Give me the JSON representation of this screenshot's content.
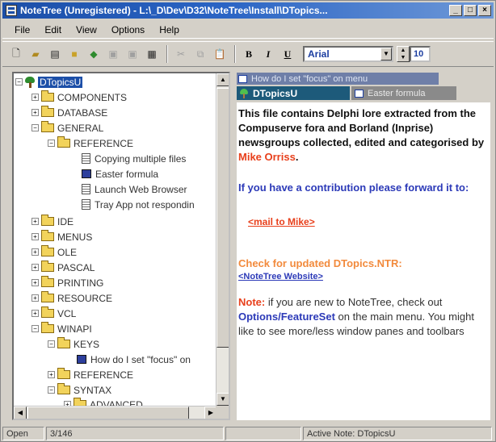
{
  "window": {
    "title": "NoteTree (Unregistered) - L:\\_D\\Dev\\D32\\NoteTree\\Install\\DTopics...",
    "buttons": {
      "minimize": "_",
      "maximize": "□",
      "close": "×"
    }
  },
  "menu": [
    "File",
    "Edit",
    "View",
    "Options",
    "Help"
  ],
  "toolbar": {
    "font_name": "Arial",
    "font_size": "10",
    "bold": "B",
    "italic": "I",
    "underline": "U"
  },
  "tree": {
    "root": "DTopicsU",
    "items": [
      {
        "label": "COMPONENTS",
        "expander": "+"
      },
      {
        "label": "DATABASE",
        "expander": "+"
      },
      {
        "label": "GENERAL",
        "expander": "−"
      },
      {
        "label": "REFERENCE",
        "expander": "−"
      },
      {
        "label": "Copying multiple files"
      },
      {
        "label": "Easter formula"
      },
      {
        "label": "Launch Web Browser"
      },
      {
        "label": "Tray App not respondin"
      },
      {
        "label": "IDE",
        "expander": "+"
      },
      {
        "label": "MENUS",
        "expander": "+"
      },
      {
        "label": "OLE",
        "expander": "+"
      },
      {
        "label": "PASCAL",
        "expander": "+"
      },
      {
        "label": "PRINTING",
        "expander": "+"
      },
      {
        "label": "RESOURCE",
        "expander": "+"
      },
      {
        "label": "VCL",
        "expander": "+"
      },
      {
        "label": "WINAPI",
        "expander": "−"
      },
      {
        "label": "KEYS",
        "expander": "−"
      },
      {
        "label": "How do I set \"focus\" on"
      },
      {
        "label": "REFERENCE",
        "expander": "+"
      },
      {
        "label": "SYNTAX",
        "expander": "−"
      },
      {
        "label": "ADVANCED",
        "expander": "+"
      }
    ]
  },
  "tabs": {
    "top": "How do I set \"focus\" on menu",
    "active": "DTopicsU",
    "inactive": "Easter formula"
  },
  "note": {
    "intro": "This file contains Delphi lore extracted from the Compuserve fora and Borland (Inprise) newsgroups collected, edited and categorised by",
    "author": "Mike Orriss",
    "period": ".",
    "contribution": "If you have a contribution please forward it to:",
    "mail_link": "<mail to Mike>",
    "check_updates": "Check for updated DTopics.NTR:",
    "website_link": "<NoteTree Website>",
    "note_label": "Note:",
    "note_text_1": "if you are new to NoteTree, check out",
    "note_bold": "Options/FeatureSet",
    "note_text_2": "on the main menu. You might like to see more/less window panes and toolbars"
  },
  "status": {
    "mode": "Open",
    "count": "3/146",
    "active_label": "Active Note:",
    "active_value": "DTopicsU"
  },
  "colors": {
    "accent_red": "#e8401c",
    "accent_blue": "#2c3ab8",
    "accent_orange": "#f28a3c",
    "selection": "#1c4fa8"
  }
}
